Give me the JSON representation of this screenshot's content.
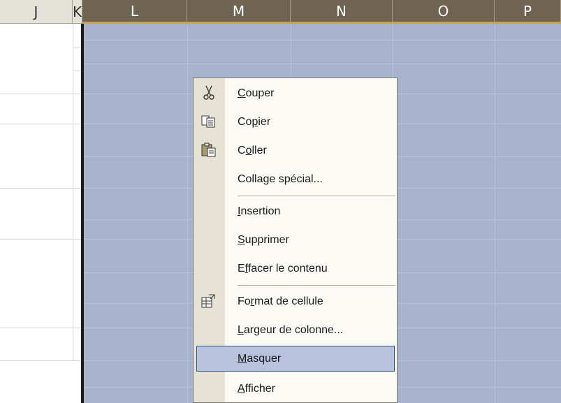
{
  "columns": [
    "J",
    "K",
    "L",
    "M",
    "N",
    "O",
    "P"
  ],
  "context_menu": {
    "items": [
      {
        "pre": "",
        "key": "C",
        "post": "ouper",
        "icon": "scissors-icon"
      },
      {
        "pre": "Co",
        "key": "p",
        "post": "ier",
        "icon": "copy-icon"
      },
      {
        "pre": "C",
        "key": "o",
        "post": "ller",
        "icon": "paste-icon"
      },
      {
        "pre": "Colla",
        "key": "g",
        "post": "e spécial...",
        "icon": ""
      },
      {
        "pre": "",
        "key": "I",
        "post": "nsertion",
        "icon": ""
      },
      {
        "pre": "",
        "key": "S",
        "post": "upprimer",
        "icon": ""
      },
      {
        "pre": "E",
        "key": "f",
        "post": "facer le contenu",
        "icon": ""
      },
      {
        "pre": "Fo",
        "key": "r",
        "post": "mat de cellule",
        "icon": "format-cells-icon"
      },
      {
        "pre": "",
        "key": "L",
        "post": "argeur de colonne...",
        "icon": ""
      },
      {
        "pre": "",
        "key": "M",
        "post": "asquer",
        "icon": ""
      },
      {
        "pre": "",
        "key": "A",
        "post": "fficher",
        "icon": ""
      }
    ],
    "highlighted_index": 9
  },
  "colors": {
    "selection": "#a7b2cd",
    "highlight": "#b7c3dd"
  }
}
